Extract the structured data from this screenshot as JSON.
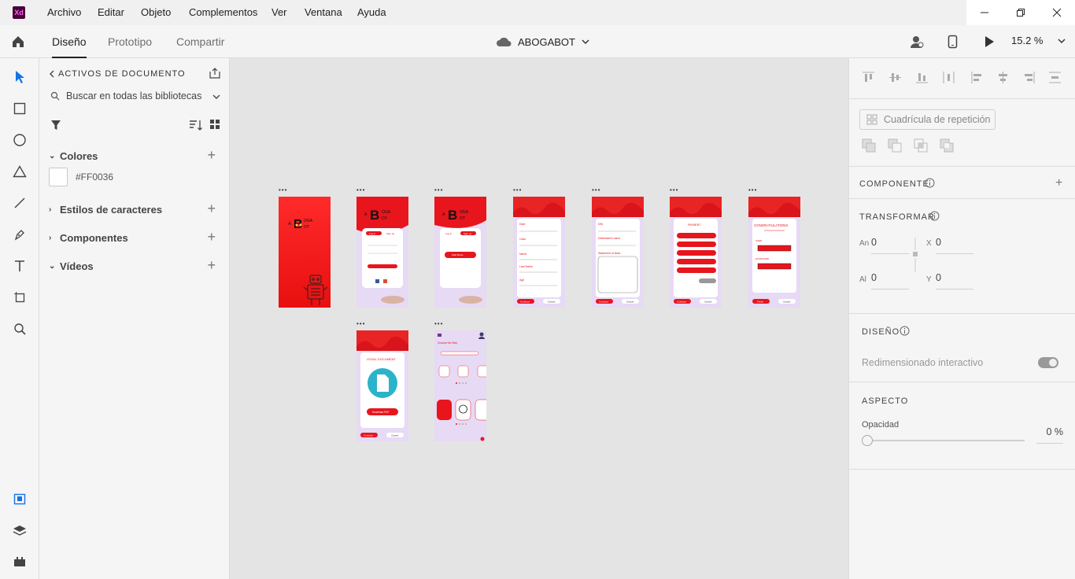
{
  "app": {
    "logo_text": "Xd",
    "menu": [
      "Archivo",
      "Editar",
      "Objeto",
      "Complementos",
      "Ver",
      "Ventana",
      "Ayuda"
    ]
  },
  "toolbar": {
    "tabs": [
      "Diseño",
      "Prototipo",
      "Compartir"
    ],
    "active_tab": "Diseño",
    "doc_title": "ABOGABOT",
    "zoom": "15.2 %"
  },
  "assets": {
    "header": "ACTIVOS DE DOCUMENTO",
    "search_placeholder": "Buscar en todas las bibliotecas",
    "sections": [
      "Colores",
      "Estilos de caracteres",
      "Componentes",
      "Vídeos"
    ],
    "color_hex": "#FF0036"
  },
  "canvas": {
    "artboard_label": "•••",
    "mini": {
      "logo_a": "A",
      "logo_b": "B",
      "logo_oga": "OGA",
      "logo_ot": "OT",
      "login": "Log in",
      "signup": "Sign up",
      "start": "Start Boom",
      "continue": "Continue",
      "cancel": "Cancel",
      "finish": "Finish",
      "date": "Date",
      "case": "Case",
      "name": "Name",
      "last_name": "Last Name",
      "age": "Age",
      "dni": "DNI",
      "defendant": "Defendant's name",
      "statement": "Statement of facts",
      "payment": "PAYMENT",
      "congrats": "CONGRATULATIONS",
      "user": "USER",
      "password": "PASSWORD",
      "legal_doc": "LEGAL DOCUMENT",
      "download": "Download PDF",
      "choose": "Choose the Step"
    }
  },
  "properties": {
    "component_label": "COMPONENTE",
    "repeat_grid": "Cuadrícula de repetición",
    "transform_label": "TRANSFORMAR",
    "width_label": "An",
    "height_label": "Al",
    "x_label": "X",
    "y_label": "Y",
    "width": "0",
    "height": "0",
    "x": "0",
    "y": "0",
    "design_label": "DISEÑO",
    "responsive_resize": "Redimensionado interactivo",
    "appearance_label": "ASPECTO",
    "opacity_label": "Opacidad",
    "opacity_value": "0 %"
  },
  "colors": {
    "accent": "#FF0036",
    "artboard_red": "#e8151d",
    "artboard_lilac": "#e7daf4"
  }
}
